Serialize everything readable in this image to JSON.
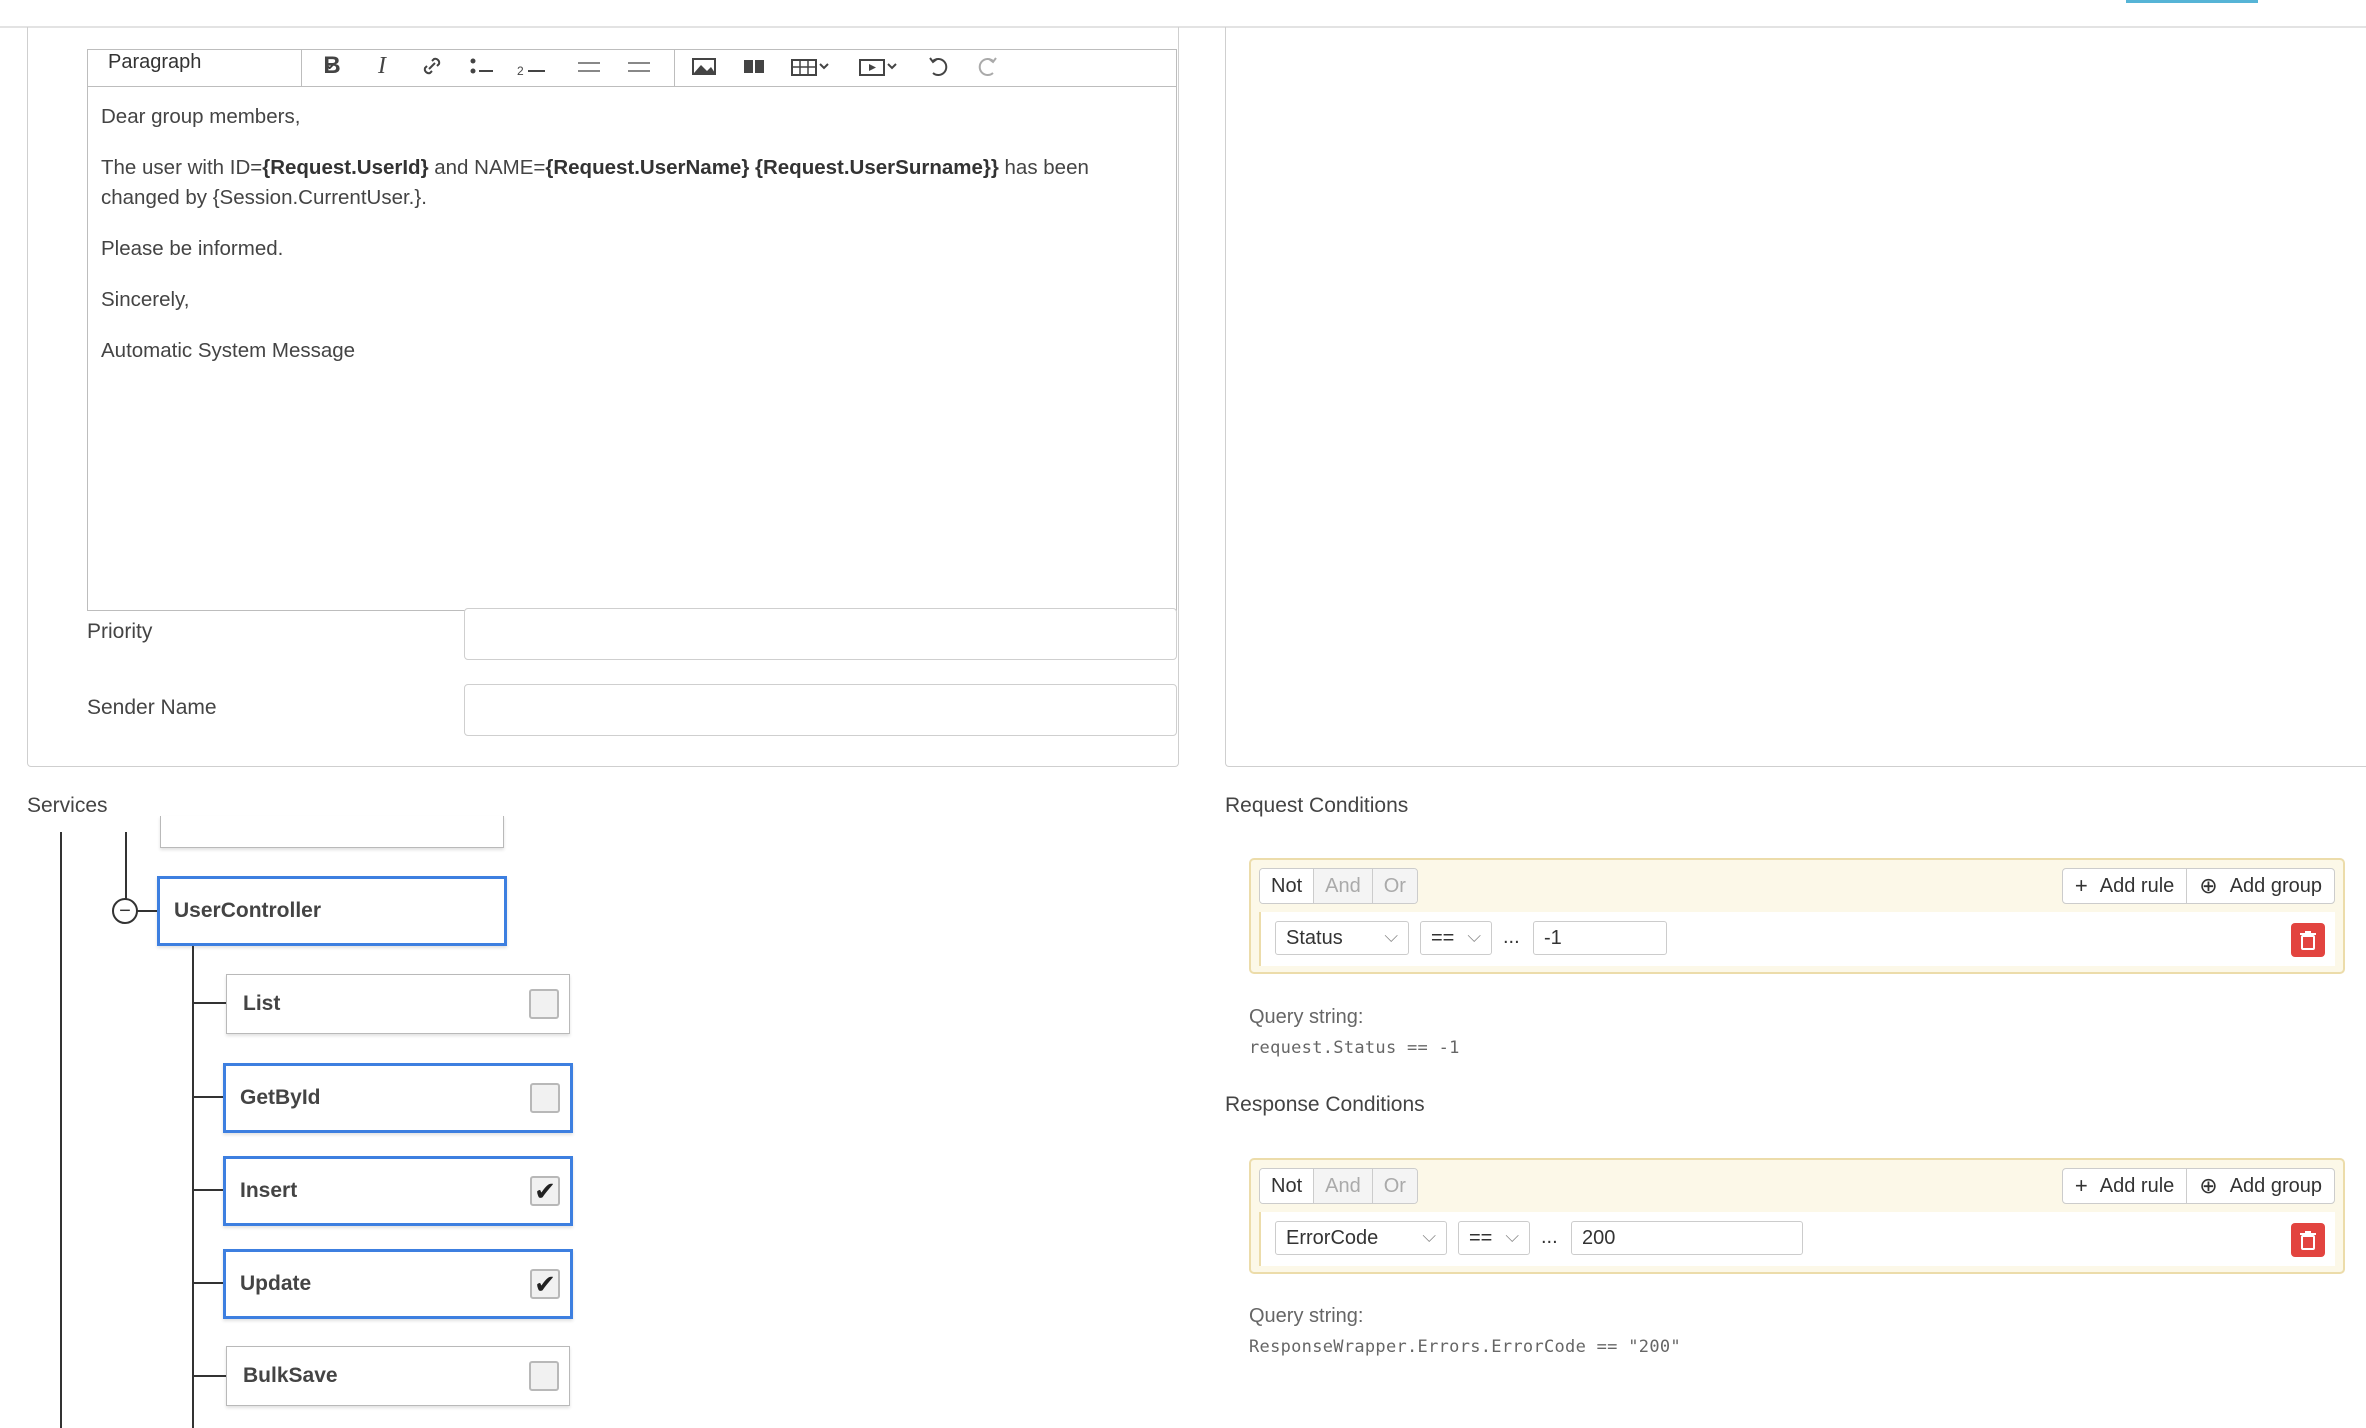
{
  "editor": {
    "format_select": "Paragraph",
    "body": {
      "greeting": "Dear group members,",
      "line1_a": "The user with ID=",
      "line1_b": "{Request.UserId}",
      "line1_c": " and NAME=",
      "line1_d": "{Request.UserName} {Request.UserSurname}}",
      "line1_e": " has been changed by {Session.CurrentUser.}.",
      "line2": "Please be informed.",
      "line3": "Sincerely,",
      "line4": "Automatic System Message"
    }
  },
  "form": {
    "priority_label": "Priority",
    "priority_value": "",
    "sender_label": "Sender Name",
    "sender_value": ""
  },
  "services": {
    "title": "Services",
    "controller": "UserController",
    "methods": [
      {
        "label": "List",
        "checked": false,
        "selected": false
      },
      {
        "label": "GetById",
        "checked": false,
        "selected": true
      },
      {
        "label": "Insert",
        "checked": true,
        "selected": true
      },
      {
        "label": "Update",
        "checked": true,
        "selected": true
      },
      {
        "label": "BulkSave",
        "checked": false,
        "selected": false
      }
    ]
  },
  "request_conditions": {
    "title": "Request Conditions",
    "logic": [
      "Not",
      "And",
      "Or"
    ],
    "add_rule": "Add rule",
    "add_group": "Add group",
    "field": "Status",
    "operator": "==",
    "dots": "...",
    "value": "-1",
    "query_label": "Query string:",
    "query": "request.Status == -1"
  },
  "response_conditions": {
    "title": "Response Conditions",
    "logic": [
      "Not",
      "And",
      "Or"
    ],
    "add_rule": "Add rule",
    "add_group": "Add group",
    "field": "ErrorCode",
    "operator": "==",
    "dots": "...",
    "value": "200",
    "query_label": "Query string:",
    "query": "ResponseWrapper.Errors.ErrorCode == \"200\""
  },
  "icons": {
    "bold": "B",
    "italic": "I",
    "check": "✔",
    "plus": "+",
    "circle_plus": "⊕",
    "minus": "−"
  },
  "colors": {
    "selected_border": "#3d7fe0",
    "qb_background": "#fcf8e8",
    "delete_button": "#e2443f",
    "accent": "#56b4d6"
  }
}
